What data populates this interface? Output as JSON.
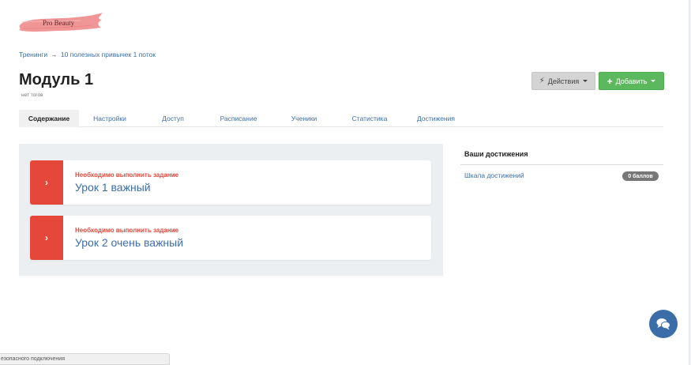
{
  "logo": {
    "text": "Pro Beauty",
    "brush_color": "#f08d8d"
  },
  "breadcrumb": {
    "root": "Тренинги",
    "separator": "→",
    "current": "10 полезных привычек 1 поток"
  },
  "header": {
    "title": "Модуль 1",
    "subtitle": "нет тогов"
  },
  "toolbar": {
    "actions_icon": "bolt-icon",
    "actions_label": "Действия",
    "add_icon": "plus-icon",
    "add_label": "Добавить"
  },
  "tabs": [
    {
      "label": "Содержание",
      "active": true
    },
    {
      "label": "Настройки",
      "active": false
    },
    {
      "label": "Доступ",
      "active": false
    },
    {
      "label": "Расписание",
      "active": false
    },
    {
      "label": "Ученики",
      "active": false
    },
    {
      "label": "Статистика",
      "active": false
    },
    {
      "label": "Достижения",
      "active": false
    }
  ],
  "lessons": [
    {
      "status": "Необходимо выполнить задание",
      "title": "Урок 1 важный",
      "marker": "›"
    },
    {
      "status": "Необходимо выполнить задание",
      "title": "Урок 2 очень важный",
      "marker": "›"
    }
  ],
  "achievements": {
    "title": "Ваши достижения",
    "link": "Шкала достижений",
    "badge": "0 баллов"
  },
  "chat": {
    "icon": "chat-bubbles-icon"
  },
  "status_bar": {
    "text": "езопасного подключения"
  },
  "colors": {
    "accent_link": "#3b6ea8",
    "lesson_marker": "#e5473a",
    "add_button": "#5cb85c",
    "actions_button": "#d4d4d4",
    "panel_bg": "#eceff1"
  }
}
